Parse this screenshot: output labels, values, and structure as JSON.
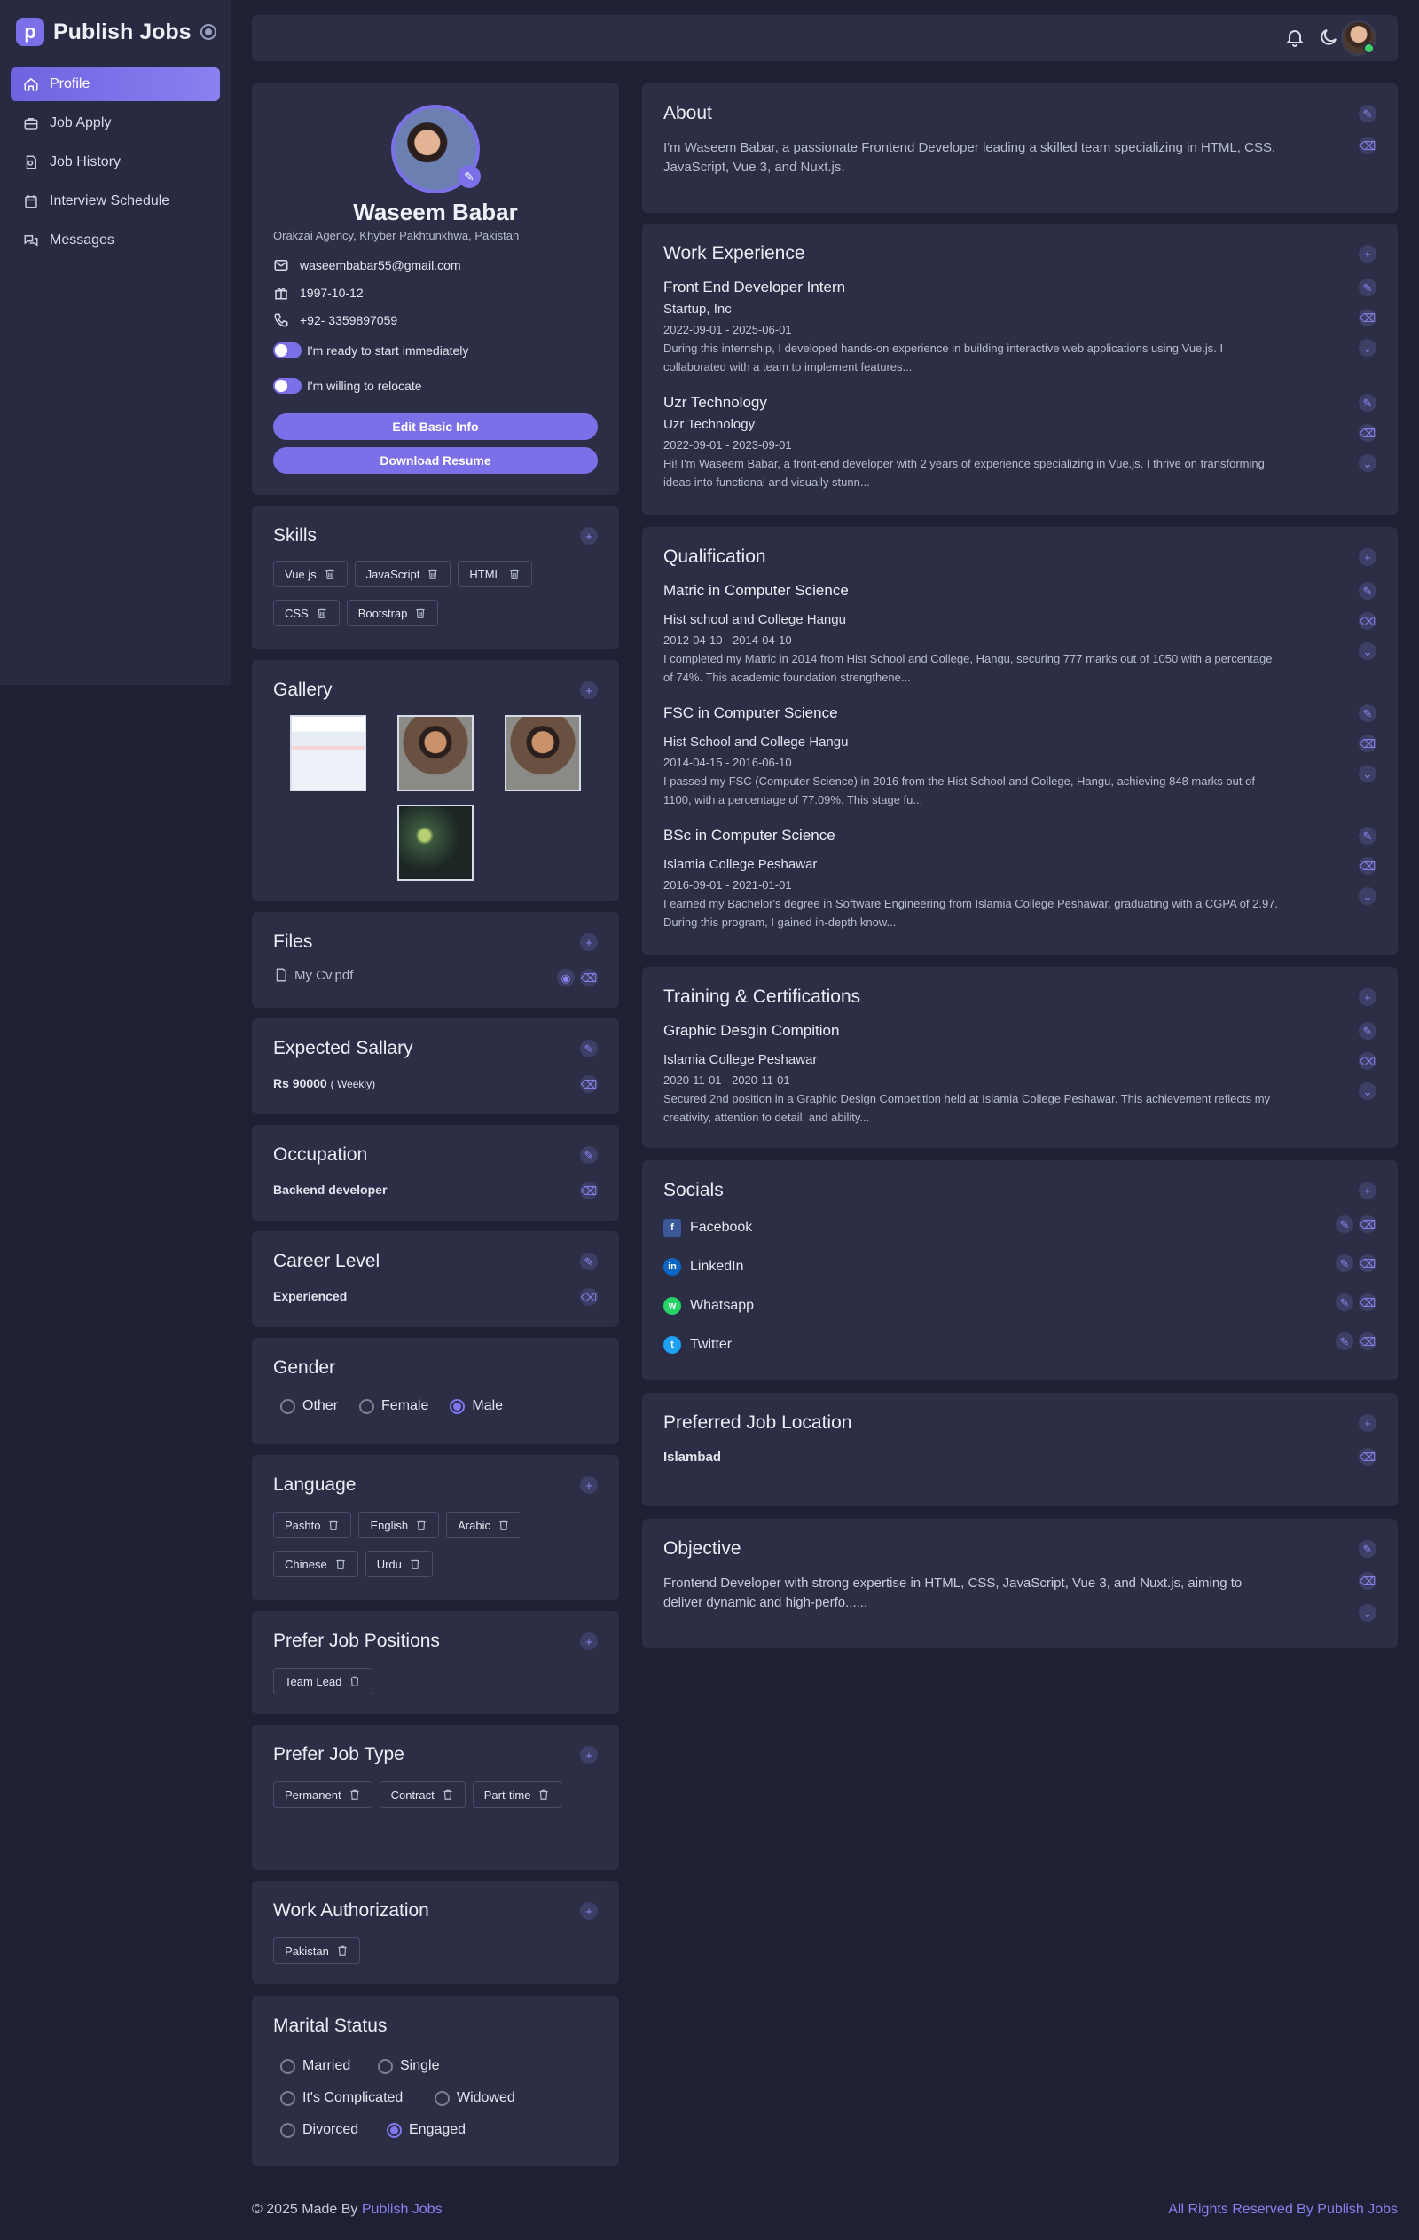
{
  "brand": {
    "name": "Publish Jobs",
    "logo_letter": "p"
  },
  "nav": {
    "items": [
      {
        "label": "Profile",
        "icon": "home-icon"
      },
      {
        "label": "Job Apply",
        "icon": "briefcase-icon"
      },
      {
        "label": "Job History",
        "icon": "document-icon"
      },
      {
        "label": "Interview Schedule",
        "icon": "calendar-icon"
      },
      {
        "label": "Messages",
        "icon": "chat-icon"
      }
    ]
  },
  "topbar": {
    "icons": [
      "bell-icon",
      "moon-icon",
      "avatar"
    ]
  },
  "profile": {
    "name": "Waseem Babar",
    "location": "Orakzai Agency, Khyber Pakhtunkhwa, Pakistan",
    "email": "waseembabar55@gmail.com",
    "dob": "1997-10-12",
    "phone": "+92- 3359897059",
    "toggle_ready": "I'm ready to start immediately",
    "toggle_relocate": "I'm willing to relocate",
    "edit_btn": "Edit Basic Info",
    "download_btn": "Download Resume"
  },
  "skills": {
    "title": "Skills",
    "items": [
      "Vue js",
      "JavaScript",
      "HTML",
      "CSS",
      "Bootstrap"
    ]
  },
  "gallery": {
    "title": "Gallery"
  },
  "files": {
    "title": "Files",
    "items": [
      "My Cv.pdf"
    ]
  },
  "salary": {
    "title": "Expected Sallary",
    "value": "Rs 90000",
    "period": "( Weekly)"
  },
  "occupation": {
    "title": "Occupation",
    "value": "Backend developer"
  },
  "career": {
    "title": "Career Level",
    "value": "Experienced"
  },
  "gender": {
    "title": "Gender",
    "options": [
      "Other",
      "Female",
      "Male"
    ],
    "selected": "Male"
  },
  "language": {
    "title": "Language",
    "items": [
      "Pashto",
      "English",
      "Arabic",
      "Chinese",
      "Urdu"
    ]
  },
  "positions": {
    "title": "Prefer Job Positions",
    "items": [
      "Team Lead"
    ]
  },
  "job_type": {
    "title": "Prefer Job Type",
    "items": [
      "Permanent",
      "Contract",
      "Part-time"
    ]
  },
  "work_auth": {
    "title": "Work Authorization",
    "items": [
      "Pakistan"
    ]
  },
  "marital": {
    "title": "Marital Status",
    "options": [
      "Married",
      "Single",
      "It's Complicated",
      "Widowed",
      "Divorced",
      "Engaged"
    ],
    "selected": "Engaged"
  },
  "about": {
    "title": "About",
    "text": "I'm Waseem Babar, a passionate Frontend Developer leading a skilled team specializing in HTML, CSS, JavaScript, Vue 3, and Nuxt.js."
  },
  "experience": {
    "title": "Work Experience",
    "items": [
      {
        "title": "Front End Developer Intern",
        "company": "Startup, Inc",
        "dates": "2022-09-01 -  2025-06-01",
        "desc": "During this internship, I developed hands-on experience in building interactive web applications using Vue.js. I collaborated with a team to implement features..."
      },
      {
        "title": "Uzr Technology",
        "company": "Uzr Technology",
        "dates": "2022-09-01 -  2023-09-01",
        "desc": "Hi! I'm Waseem Babar, a front-end developer with 2 years of experience specializing in Vue.js. I thrive on transforming ideas into functional and visually stunn..."
      }
    ]
  },
  "qualification": {
    "title": "Qualification",
    "items": [
      {
        "title": "Matric in Computer Science",
        "school": "Hist school and College Hangu",
        "dates": "2012-04-10 -  2014-04-10",
        "desc": "I completed my Matric in 2014 from Hist School and College, Hangu, securing 777 marks out of 1050 with a percentage of 74%. This academic foundation strengthene..."
      },
      {
        "title": "FSC in Computer Science",
        "school": "Hist School and College Hangu",
        "dates": "2014-04-15 -  2016-06-10",
        "desc": "I passed my FSC (Computer Science) in 2016 from the Hist School and College, Hangu, achieving 848 marks out of 1100, with a percentage of 77.09%. This stage fu..."
      },
      {
        "title": "BSc in Computer Science",
        "school": "Islamia College Peshawar",
        "dates": "2016-09-01 -  2021-01-01",
        "desc": "I earned my Bachelor's degree in Software Engineering from Islamia College Peshawar, graduating with a CGPA of 2.97. During this program, I gained in-depth know..."
      }
    ]
  },
  "training": {
    "title": "Training & Certifications",
    "items": [
      {
        "title": "Graphic Desgin Compition",
        "school": "Islamia College Peshawar",
        "dates": "2020-11-01 - 2020-11-01",
        "desc": "Secured 2nd position in a Graphic Design Competition held at Islamia College Peshawar. This achievement reflects my creativity, attention to detail, and ability..."
      }
    ]
  },
  "socials": {
    "title": "Socials",
    "items": [
      {
        "label": "Facebook",
        "color": "#3b5998",
        "glyph": "f"
      },
      {
        "label": "LinkedIn",
        "color": "#0a66c2",
        "glyph": "in"
      },
      {
        "label": "Whatsapp",
        "color": "#25d366",
        "glyph": "w"
      },
      {
        "label": "Twitter",
        "color": "#1da1f2",
        "glyph": "t"
      }
    ]
  },
  "location": {
    "title": "Preferred Job Location",
    "value": "Islambad"
  },
  "objective": {
    "title": "Objective",
    "text": "Frontend Developer with strong expertise in HTML, CSS, JavaScript, Vue 3, and Nuxt.js, aiming to deliver dynamic and high-perfo......"
  },
  "footer": {
    "left_prefix": "© 2025 Made By ",
    "left_link": "Publish Jobs",
    "right": "All Rights Reserved By Publish Jobs"
  },
  "colors": {
    "accent": "#7b70e8",
    "bg": "#1e2134",
    "card": "#2b2e45"
  }
}
